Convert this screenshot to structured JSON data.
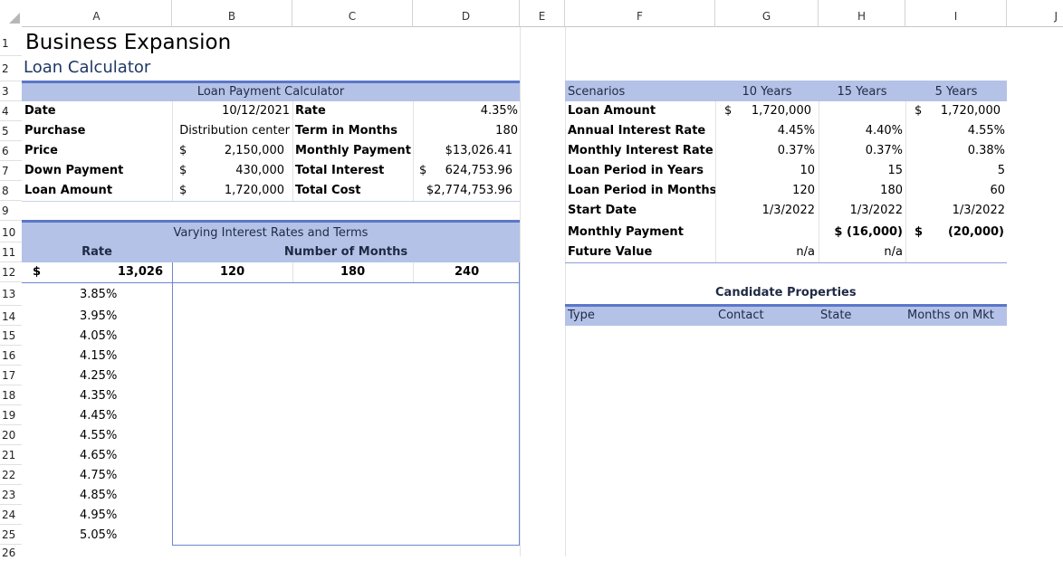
{
  "columns": [
    "A",
    "B",
    "C",
    "D",
    "E",
    "F",
    "G",
    "H",
    "I",
    "J"
  ],
  "rows": [
    "1",
    "2",
    "3",
    "4",
    "5",
    "6",
    "7",
    "8",
    "9",
    "10",
    "11",
    "12",
    "13",
    "14",
    "15",
    "16",
    "17",
    "18",
    "19",
    "20",
    "21",
    "22",
    "23",
    "24",
    "25",
    "26"
  ],
  "title": "Business Expansion",
  "subtitle": "Loan Calculator",
  "loan_calc": {
    "header": "Loan Payment Calculator",
    "date_label": "Date",
    "date_value": "10/12/2021",
    "rate_label": "Rate",
    "rate_value": "4.35%",
    "purchase_label": "Purchase",
    "purchase_value": "Distribution center",
    "term_label": "Term in Months",
    "term_value": "180",
    "price_label": "Price",
    "price_cur": "$",
    "price_value": "2,150,000",
    "monthly_label": "Monthly Payment",
    "monthly_value": "$13,026.41",
    "down_label": "Down Payment",
    "down_cur": "$",
    "down_value": "430,000",
    "interest_label": "Total Interest",
    "interest_cur": "$",
    "interest_value": "624,753.96",
    "loan_label": "Loan Amount",
    "loan_cur": "$",
    "loan_value": "1,720,000",
    "cost_label": "Total Cost",
    "cost_value": "$2,774,753.96"
  },
  "varying": {
    "header": "Varying Interest Rates and Terms",
    "rate_label": "Rate",
    "months_label": "Number of Months",
    "pmt_cur": "$",
    "pmt_value": "13,026",
    "terms": [
      "120",
      "180",
      "240"
    ],
    "rates": [
      "3.85%",
      "3.95%",
      "4.05%",
      "4.15%",
      "4.25%",
      "4.35%",
      "4.45%",
      "4.55%",
      "4.65%",
      "4.75%",
      "4.85%",
      "4.95%",
      "5.05%"
    ]
  },
  "scenarios": {
    "header": "Scenarios",
    "col_10": "10 Years",
    "col_15": "15 Years",
    "col_5": "5 Years",
    "loan_amount_label": "Loan Amount",
    "loan_10_cur": "$",
    "loan_10": "1,720,000",
    "loan_5_cur": "$",
    "loan_5": "1,720,000",
    "annual_label": "Annual Interest Rate",
    "annual_10": "4.45%",
    "annual_15": "4.40%",
    "annual_5": "4.55%",
    "monthly_rate_label": "Monthly Interest Rate",
    "mrate_10": "0.37%",
    "mrate_15": "0.37%",
    "mrate_5": "0.38%",
    "years_label": "Loan Period in Years",
    "years_10": "10",
    "years_15": "15",
    "years_5": "5",
    "months_label": "Loan Period in Months",
    "months_10": "120",
    "months_15": "180",
    "months_5": "60",
    "start_label": "Start Date",
    "start_10": "1/3/2022",
    "start_15": "1/3/2022",
    "start_5": "1/3/2022",
    "payment_label": "Monthly Payment",
    "pay_15": "$ (16,000)",
    "pay_15_cur2": "$",
    "pay_5": "(20,000)",
    "fv_label": "Future Value",
    "fv_10": "n/a",
    "fv_15": "n/a"
  },
  "properties": {
    "header": "Candidate Properties",
    "type": "Type",
    "contact": "Contact",
    "state": "State",
    "months": "Months on Mkt"
  }
}
